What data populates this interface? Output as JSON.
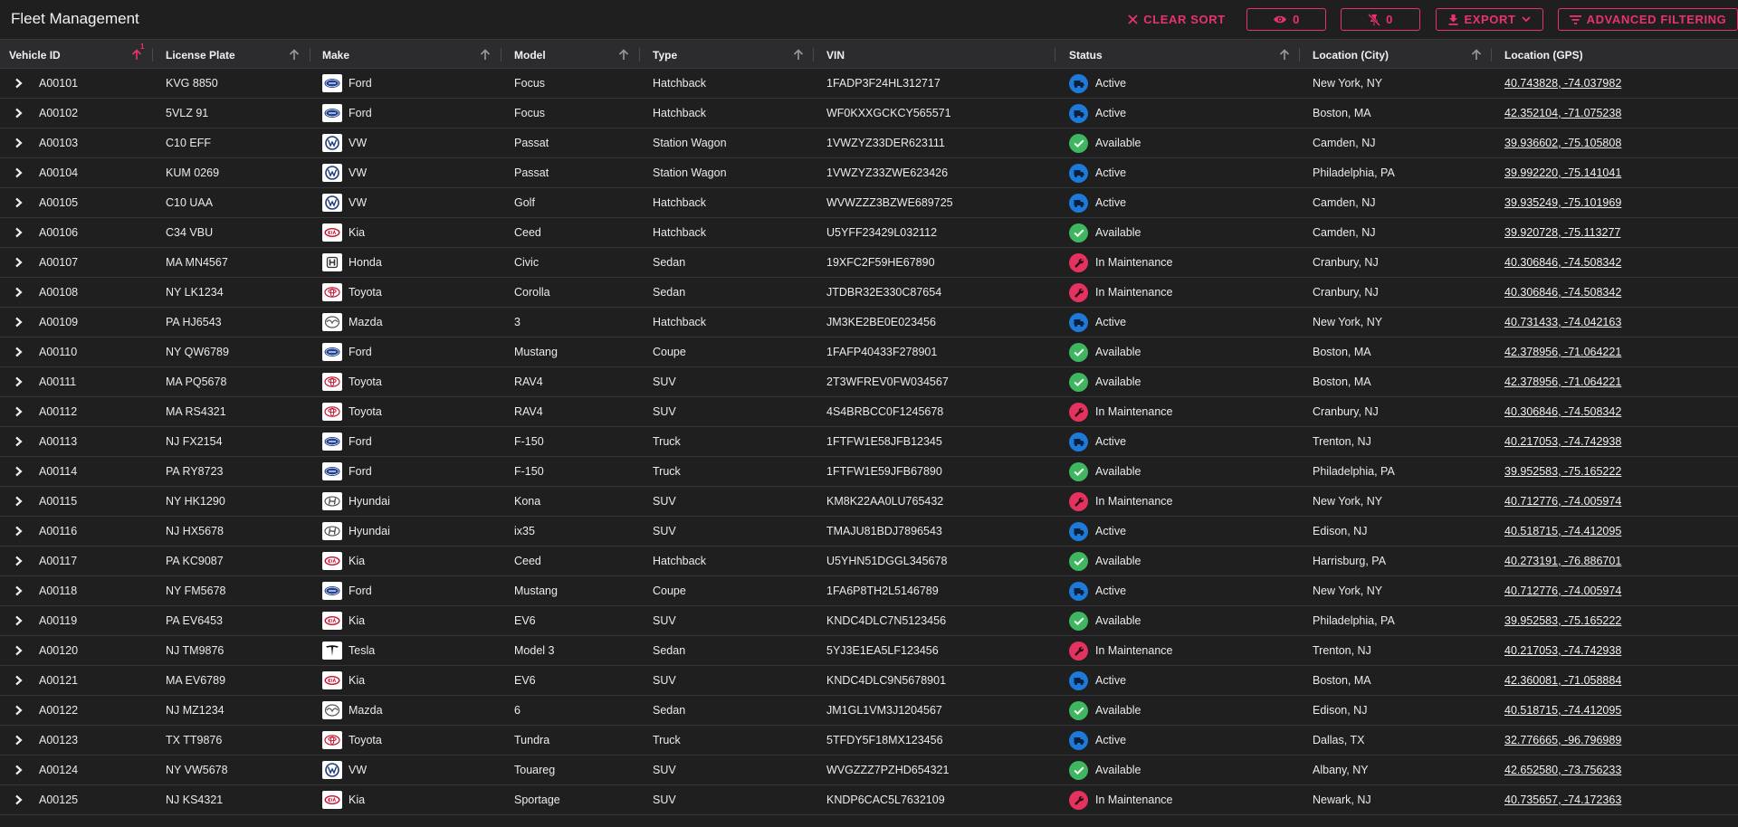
{
  "app": {
    "title": "Fleet Management"
  },
  "toolbar": {
    "clear_sort": "CLEAR SORT",
    "views_count": "0",
    "pins_count": "0",
    "export": "EXPORT",
    "advanced_filtering": "ADVANCED FILTERING"
  },
  "colors": {
    "accent": "#e8336d",
    "active": "#1e7ad8",
    "available": "#3fb660",
    "maintenance": "#e4335f",
    "background": "#1f1f20",
    "header": "#2c2c2e"
  },
  "columns": [
    {
      "key": "id",
      "label": "Vehicle ID",
      "sort": "asc",
      "sort_index": "1"
    },
    {
      "key": "plate",
      "label": "License Plate",
      "sort": "none"
    },
    {
      "key": "make",
      "label": "Make",
      "sort": "none"
    },
    {
      "key": "model",
      "label": "Model",
      "sort": "none"
    },
    {
      "key": "type",
      "label": "Type",
      "sort": "none"
    },
    {
      "key": "vin",
      "label": "VIN",
      "sort": "none"
    },
    {
      "key": "status",
      "label": "Status",
      "sort": "none"
    },
    {
      "key": "city",
      "label": "Location (City)",
      "sort": "none"
    },
    {
      "key": "gps",
      "label": "Location (GPS)",
      "sort": "none"
    }
  ],
  "make_icons": {
    "Ford": "ford-logo-icon",
    "VW": "vw-logo-icon",
    "Kia": "kia-logo-icon",
    "Honda": "honda-logo-icon",
    "Toyota": "toyota-logo-icon",
    "Mazda": "mazda-logo-icon",
    "Hyundai": "hyundai-logo-icon",
    "Tesla": "tesla-logo-icon"
  },
  "status_icons": {
    "Active": "truck-icon",
    "Available": "check-icon",
    "In Maintenance": "wrench-icon"
  },
  "rows": [
    {
      "id": "A00101",
      "plate": "KVG 8850",
      "make": "Ford",
      "model": "Focus",
      "type": "Hatchback",
      "vin": "1FADP3F24HL312717",
      "status": "Active",
      "city": "New York, NY",
      "gps": "40.743828, -74.037982"
    },
    {
      "id": "A00102",
      "plate": "5VLZ 91",
      "make": "Ford",
      "model": "Focus",
      "type": "Hatchback",
      "vin": "WF0KXXGCKCY565571",
      "status": "Active",
      "city": "Boston, MA",
      "gps": "42.352104, -71.075238"
    },
    {
      "id": "A00103",
      "plate": "C10 EFF",
      "make": "VW",
      "model": "Passat",
      "type": "Station Wagon",
      "vin": "1VWZYZ33DER623111",
      "status": "Available",
      "city": "Camden, NJ",
      "gps": "39.936602, -75.105808"
    },
    {
      "id": "A00104",
      "plate": "KUM 0269",
      "make": "VW",
      "model": "Passat",
      "type": "Station Wagon",
      "vin": "1VWZYZ33ZWE623426",
      "status": "Active",
      "city": "Philadelphia, PA",
      "gps": "39.992220, -75.141041"
    },
    {
      "id": "A00105",
      "plate": "C10 UAA",
      "make": "VW",
      "model": "Golf",
      "type": "Hatchback",
      "vin": "WVWZZZ3BZWE689725",
      "status": "Active",
      "city": "Camden, NJ",
      "gps": "39.935249, -75.101969"
    },
    {
      "id": "A00106",
      "plate": "C34 VBU",
      "make": "Kia",
      "model": "Ceed",
      "type": "Hatchback",
      "vin": "U5YFF23429L032112",
      "status": "Available",
      "city": "Camden, NJ",
      "gps": "39.920728, -75.113277"
    },
    {
      "id": "A00107",
      "plate": "MA MN4567",
      "make": "Honda",
      "model": "Civic",
      "type": "Sedan",
      "vin": "19XFC2F59HE67890",
      "status": "In Maintenance",
      "city": "Cranbury, NJ",
      "gps": "40.306846, -74.508342"
    },
    {
      "id": "A00108",
      "plate": "NY LK1234",
      "make": "Toyota",
      "model": "Corolla",
      "type": "Sedan",
      "vin": "JTDBR32E330C87654",
      "status": "In Maintenance",
      "city": "Cranbury, NJ",
      "gps": "40.306846, -74.508342"
    },
    {
      "id": "A00109",
      "plate": "PA HJ6543",
      "make": "Mazda",
      "model": "3",
      "type": "Hatchback",
      "vin": "JM3KE2BE0E023456",
      "status": "Active",
      "city": "New York, NY",
      "gps": "40.731433, -74.042163"
    },
    {
      "id": "A00110",
      "plate": "NY QW6789",
      "make": "Ford",
      "model": "Mustang",
      "type": "Coupe",
      "vin": "1FAFP40433F278901",
      "status": "Available",
      "city": "Boston, MA",
      "gps": "42.378956, -71.064221"
    },
    {
      "id": "A00111",
      "plate": "MA PQ5678",
      "make": "Toyota",
      "model": "RAV4",
      "type": "SUV",
      "vin": "2T3WFREV0FW034567",
      "status": "Available",
      "city": "Boston, MA",
      "gps": "42.378956, -71.064221"
    },
    {
      "id": "A00112",
      "plate": "MA RS4321",
      "make": "Toyota",
      "model": "RAV4",
      "type": "SUV",
      "vin": "4S4BRBCC0F1245678",
      "status": "In Maintenance",
      "city": "Cranbury, NJ",
      "gps": "40.306846, -74.508342"
    },
    {
      "id": "A00113",
      "plate": "NJ FX2154",
      "make": "Ford",
      "model": "F-150",
      "type": "Truck",
      "vin": "1FTFW1E58JFB12345",
      "status": "Active",
      "city": "Trenton, NJ",
      "gps": "40.217053, -74.742938"
    },
    {
      "id": "A00114",
      "plate": "PA RY8723",
      "make": "Ford",
      "model": "F-150",
      "type": "Truck",
      "vin": "1FTFW1E59JFB67890",
      "status": "Available",
      "city": "Philadelphia, PA",
      "gps": "39.952583, -75.165222"
    },
    {
      "id": "A00115",
      "plate": "NY HK1290",
      "make": "Hyundai",
      "model": "Kona",
      "type": "SUV",
      "vin": "KM8K22AA0LU765432",
      "status": "In Maintenance",
      "city": "New York, NY",
      "gps": "40.712776, -74.005974"
    },
    {
      "id": "A00116",
      "plate": "NJ HX5678",
      "make": "Hyundai",
      "model": "ix35",
      "type": "SUV",
      "vin": "TMAJU81BDJ7896543",
      "status": "Active",
      "city": "Edison, NJ",
      "gps": "40.518715, -74.412095"
    },
    {
      "id": "A00117",
      "plate": "PA KC9087",
      "make": "Kia",
      "model": "Ceed",
      "type": "Hatchback",
      "vin": "U5YHN51DGGL345678",
      "status": "Available",
      "city": "Harrisburg, PA",
      "gps": "40.273191, -76.886701"
    },
    {
      "id": "A00118",
      "plate": "NY FM5678",
      "make": "Ford",
      "model": "Mustang",
      "type": "Coupe",
      "vin": "1FA6P8TH2L5146789",
      "status": "Active",
      "city": "New York, NY",
      "gps": "40.712776, -74.005974"
    },
    {
      "id": "A00119",
      "plate": "PA EV6453",
      "make": "Kia",
      "model": "EV6",
      "type": "SUV",
      "vin": "KNDC4DLC7N5123456",
      "status": "Available",
      "city": "Philadelphia, PA",
      "gps": "39.952583, -75.165222"
    },
    {
      "id": "A00120",
      "plate": "NJ TM9876",
      "make": "Tesla",
      "model": "Model 3",
      "type": "Sedan",
      "vin": "5YJ3E1EA5LF123456",
      "status": "In Maintenance",
      "city": "Trenton, NJ",
      "gps": "40.217053, -74.742938"
    },
    {
      "id": "A00121",
      "plate": "MA EV6789",
      "make": "Kia",
      "model": "EV6",
      "type": "SUV",
      "vin": "KNDC4DLC9N5678901",
      "status": "Active",
      "city": "Boston, MA",
      "gps": "42.360081, -71.058884"
    },
    {
      "id": "A00122",
      "plate": "NJ MZ1234",
      "make": "Mazda",
      "model": "6",
      "type": "Sedan",
      "vin": "JM1GL1VM3J1204567",
      "status": "Available",
      "city": "Edison, NJ",
      "gps": "40.518715, -74.412095"
    },
    {
      "id": "A00123",
      "plate": "TX TT9876",
      "make": "Toyota",
      "model": "Tundra",
      "type": "Truck",
      "vin": "5TFDY5F18MX123456",
      "status": "Active",
      "city": "Dallas, TX",
      "gps": "32.776665, -96.796989"
    },
    {
      "id": "A00124",
      "plate": "NY VW5678",
      "make": "VW",
      "model": "Touareg",
      "type": "SUV",
      "vin": "WVGZZZ7PZHD654321",
      "status": "Available",
      "city": "Albany, NY",
      "gps": "42.652580, -73.756233"
    },
    {
      "id": "A00125",
      "plate": "NJ KS4321",
      "make": "Kia",
      "model": "Sportage",
      "type": "SUV",
      "vin": "KNDP6CAC5L7632109",
      "status": "In Maintenance",
      "city": "Newark, NJ",
      "gps": "40.735657, -74.172363"
    }
  ]
}
